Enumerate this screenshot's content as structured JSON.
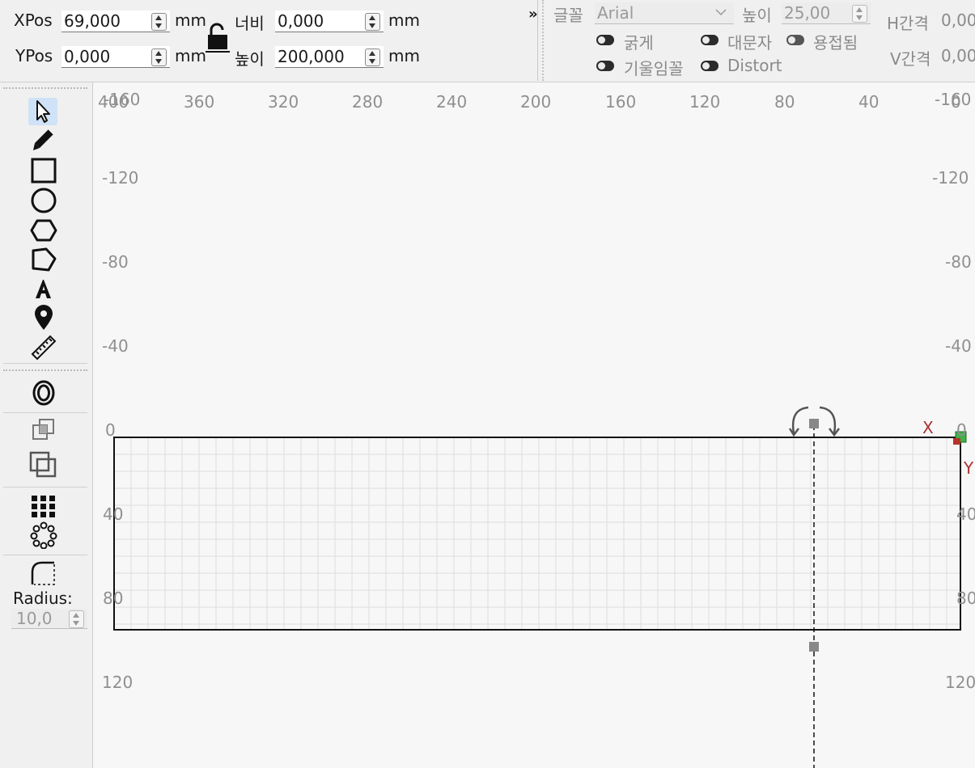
{
  "toolbar": {
    "xpos": {
      "label": "XPos",
      "value": "69,000",
      "unit": "mm"
    },
    "ypos": {
      "label": "YPos",
      "value": "0,000",
      "unit": "mm"
    },
    "width": {
      "label": "너비",
      "value": "0,000",
      "unit": "mm"
    },
    "height": {
      "label": "높이",
      "value": "200,000",
      "unit": "mm"
    },
    "expand": "»"
  },
  "text_options": {
    "font_label": "글꼴",
    "font_value": "Arial",
    "height_label": "높이",
    "height_value": "25,00",
    "hspace_label": "H간격",
    "hspace_value": "0,00",
    "vspace_label": "V간격",
    "vspace_value": "0,00",
    "bold": "굵게",
    "uppercase": "대문자",
    "welded": "용접됨",
    "italic": "기울임꼴",
    "distort": "Distort"
  },
  "left_panel": {
    "tools": [
      "select-icon",
      "pencil-icon",
      "rectangle-icon",
      "ellipse-icon",
      "polygon-icon",
      "pentagon-icon",
      "text-icon",
      "position-pin-icon",
      "measure-icon",
      "offset-icon",
      "boolean-union-icon",
      "boolean-subtract-icon",
      "grid-array-icon",
      "circular-array-icon",
      "corner-radius-icon"
    ],
    "radius_label": "Radius:",
    "radius_value": "10,0"
  },
  "rulers": {
    "top": [
      "400",
      "360",
      "320",
      "280",
      "240",
      "200",
      "160",
      "120",
      "80",
      "40",
      "0"
    ],
    "top_overlap_left": "-160",
    "top_overlap_right": "-160",
    "left": [
      "-120",
      "-80",
      "-40",
      "0",
      "40",
      "80",
      "120"
    ],
    "right": [
      "-120",
      "-80",
      "-40",
      "0",
      "40",
      "80",
      "120"
    ]
  },
  "canvas": {
    "axis_x": "X",
    "axis_y": "Y"
  },
  "colors": {
    "toolbar_bg": "#f0f0f0",
    "canvas_bg": "#f7f7f7",
    "grid_line": "#dedede",
    "selected_tool": "#cfe2f7",
    "origin_green": "#3fb24a",
    "origin_red": "#b8332a"
  }
}
